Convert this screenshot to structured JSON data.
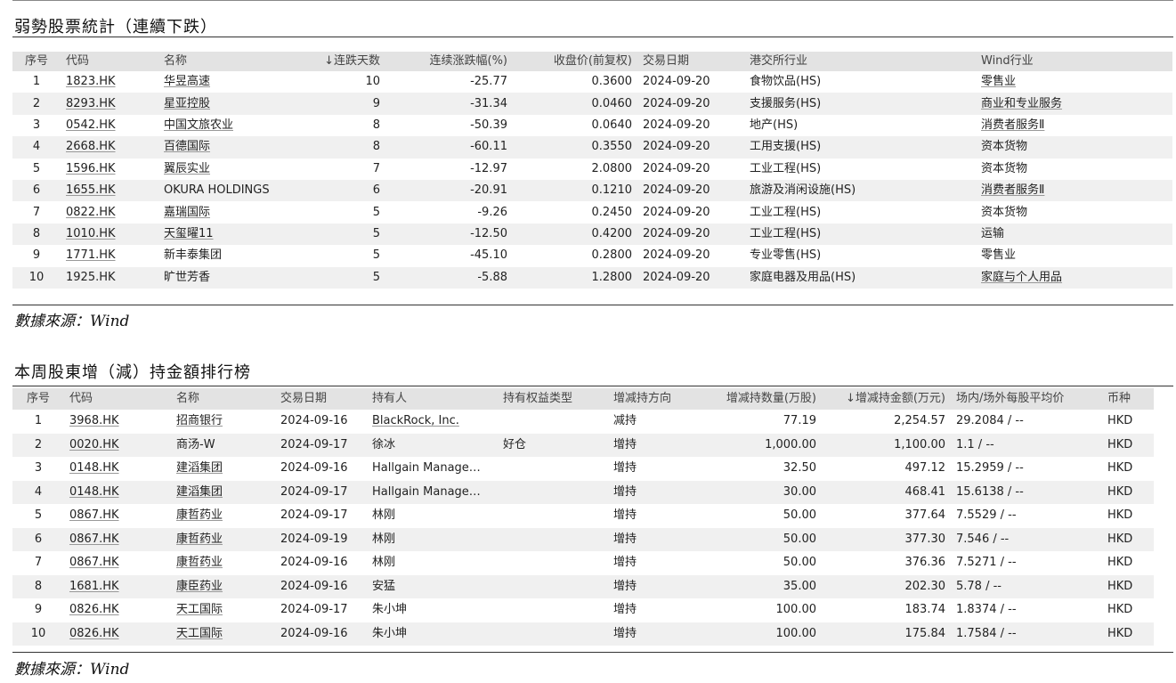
{
  "section1": {
    "title": "弱勢股票統計（連續下跌）",
    "source": "數據來源：Wind",
    "headers": [
      "序号",
      "代码",
      "名称",
      "↓连跌天数",
      "连续涨跌幅(%)",
      "收盘价(前复权)",
      "交易日期",
      "港交所行业",
      "Wind行业"
    ],
    "rows": [
      [
        "1",
        "1823.HK",
        "华昱高速",
        "10",
        "-25.77",
        "0.3600",
        "2024-09-20",
        "食物饮品(HS)",
        "零售业"
      ],
      [
        "2",
        "8293.HK",
        "星亚控股",
        "9",
        "-31.34",
        "0.0460",
        "2024-09-20",
        "支援服务(HS)",
        "商业和专业服务"
      ],
      [
        "3",
        "0542.HK",
        "中国文旅农业",
        "8",
        "-50.39",
        "0.0640",
        "2024-09-20",
        "地产(HS)",
        "消费者服务Ⅱ"
      ],
      [
        "4",
        "2668.HK",
        "百德国际",
        "8",
        "-60.11",
        "0.3550",
        "2024-09-20",
        "工用支援(HS)",
        "资本货物"
      ],
      [
        "5",
        "1596.HK",
        "翼辰实业",
        "7",
        "-12.97",
        "2.0800",
        "2024-09-20",
        "工业工程(HS)",
        "资本货物"
      ],
      [
        "6",
        "1655.HK",
        "OKURA HOLDINGS",
        "6",
        "-20.91",
        "0.1210",
        "2024-09-20",
        "旅游及消闲设施(HS)",
        "消费者服务Ⅱ"
      ],
      [
        "7",
        "0822.HK",
        "嘉瑞国际",
        "5",
        "-9.26",
        "0.2450",
        "2024-09-20",
        "工业工程(HS)",
        "资本货物"
      ],
      [
        "8",
        "1010.HK",
        "天玺曜11",
        "5",
        "-12.50",
        "0.4200",
        "2024-09-20",
        "工业工程(HS)",
        "运输"
      ],
      [
        "9",
        "1771.HK",
        "新丰泰集团",
        "5",
        "-45.10",
        "0.2800",
        "2024-09-20",
        "专业零售(HS)",
        "零售业"
      ],
      [
        "10",
        "1925.HK",
        "旷世芳香",
        "5",
        "-5.88",
        "1.2800",
        "2024-09-20",
        "家庭电器及用品(HS)",
        "家庭与个人用品"
      ]
    ]
  },
  "section2": {
    "title": "本周股東增（減）持金額排行榜",
    "source": "數據來源：Wind",
    "headers": [
      "序号",
      "代码",
      "名称",
      "交易日期",
      "持有人",
      "持有权益类型",
      "增减持方向",
      "增减持数量(万股)",
      "↓增减持金额(万元)",
      "场内/场外每股平均价",
      "币种"
    ],
    "rows": [
      [
        "1",
        "3968.HK",
        "招商银行",
        "2024-09-16",
        "BlackRock, Inc.",
        "",
        "减持",
        "77.19",
        "2,254.57",
        "29.2084 / --",
        "HKD"
      ],
      [
        "2",
        "0020.HK",
        "商汤-W",
        "2024-09-17",
        "徐冰",
        "好仓",
        "增持",
        "1,000.00",
        "1,100.00",
        "1.1 / --",
        "HKD"
      ],
      [
        "3",
        "0148.HK",
        "建滔集团",
        "2024-09-16",
        "Hallgain Manage…",
        "",
        "增持",
        "32.50",
        "497.12",
        "15.2959 / --",
        "HKD"
      ],
      [
        "4",
        "0148.HK",
        "建滔集团",
        "2024-09-17",
        "Hallgain Manage…",
        "",
        "增持",
        "30.00",
        "468.41",
        "15.6138 / --",
        "HKD"
      ],
      [
        "5",
        "0867.HK",
        "康哲药业",
        "2024-09-17",
        "林刚",
        "",
        "增持",
        "50.00",
        "377.64",
        "7.5529 / --",
        "HKD"
      ],
      [
        "6",
        "0867.HK",
        "康哲药业",
        "2024-09-19",
        "林刚",
        "",
        "增持",
        "50.00",
        "377.30",
        "7.546 / --",
        "HKD"
      ],
      [
        "7",
        "0867.HK",
        "康哲药业",
        "2024-09-16",
        "林刚",
        "",
        "增持",
        "50.00",
        "376.36",
        "7.5271 / --",
        "HKD"
      ],
      [
        "8",
        "1681.HK",
        "康臣药业",
        "2024-09-16",
        "安猛",
        "",
        "增持",
        "35.00",
        "202.30",
        "5.78 / --",
        "HKD"
      ],
      [
        "9",
        "0826.HK",
        "天工国际",
        "2024-09-17",
        "朱小坤",
        "",
        "增持",
        "100.00",
        "183.74",
        "1.8374 / --",
        "HKD"
      ],
      [
        "10",
        "0826.HK",
        "天工国际",
        "2024-09-16",
        "朱小坤",
        "",
        "增持",
        "100.00",
        "175.84",
        "1.7584 / --",
        "HKD"
      ]
    ]
  }
}
